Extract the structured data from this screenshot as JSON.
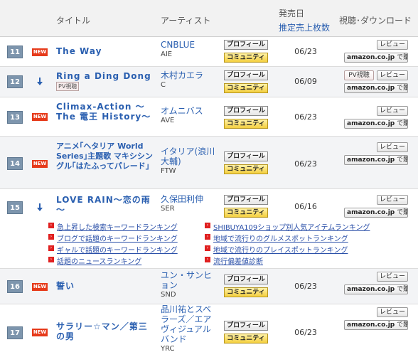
{
  "header": {
    "title_col": "タイトル",
    "artist_col": "アーティスト",
    "release_col": "発売日",
    "sales_col": "推定売上枚数",
    "media_col": "視聴･ダウンロード"
  },
  "buttons": {
    "profile": "プロフィール",
    "community": "コミュニティ",
    "review": "レビュー",
    "pv": "PV視聴",
    "amazon_brand": "amazon.co.jp",
    "amazon_action": "で購入"
  },
  "badges": {
    "new": "NEW",
    "pv": "PV視聴"
  },
  "rows": [
    {
      "rank": "11",
      "status": "new",
      "title": "The Way",
      "artist": "CNBLUE",
      "code": "AIE",
      "date": "06/23"
    },
    {
      "rank": "12",
      "status": "down",
      "title": "Ring a Ding Dong",
      "artist": "木村カエラ",
      "code": "C",
      "date": "06/09"
    },
    {
      "rank": "13",
      "status": "new",
      "title": "Climax-Action ～The 電王 History～",
      "artist": "オムニバス",
      "code": "AVE",
      "date": "06/23"
    },
    {
      "rank": "14",
      "status": "new",
      "title": "アニメ｢ヘタリア World Series｣主題歌 マキシシングル｢はたふってパレード｣",
      "artist": "イタリア(浪川大輔)",
      "code": "FTW",
      "date": "06/23"
    },
    {
      "rank": "15",
      "status": "down",
      "title": "LOVE RAIN～恋の雨～",
      "artist": "久保田利伸",
      "code": "SER",
      "date": "06/16"
    },
    {
      "rank": "16",
      "status": "new",
      "title": "誓い",
      "artist": "ユン・サンヒョン",
      "code": "SND",
      "date": "06/23"
    },
    {
      "rank": "17",
      "status": "new",
      "title": "サラリー☆マン／第三の男",
      "artist": "品川祐とスベラーズ／エアヴィジュアルバンド",
      "code": "YRC",
      "date": "06/23"
    }
  ],
  "links": {
    "left": [
      "急上昇した検索キーワードランキング",
      "ブログで話題のキーワードランキング",
      "ギャルで話題のキーワードランキング",
      "話題のニュースランキング"
    ],
    "right": [
      "SHIBUYA109ショップ別人気アイテムランキング",
      "地域で流行りのグルメスポットランキング",
      "地域で流行りのプレイスポットランキング",
      "流行偏差値診断"
    ]
  },
  "colors": {
    "rank_badge": "#7d95ad",
    "new_badge": "#e63a1a",
    "link_blue": "#2a5fb0",
    "community_yellow": "#f4cf3f",
    "alt_row": "#f3f4f6"
  }
}
